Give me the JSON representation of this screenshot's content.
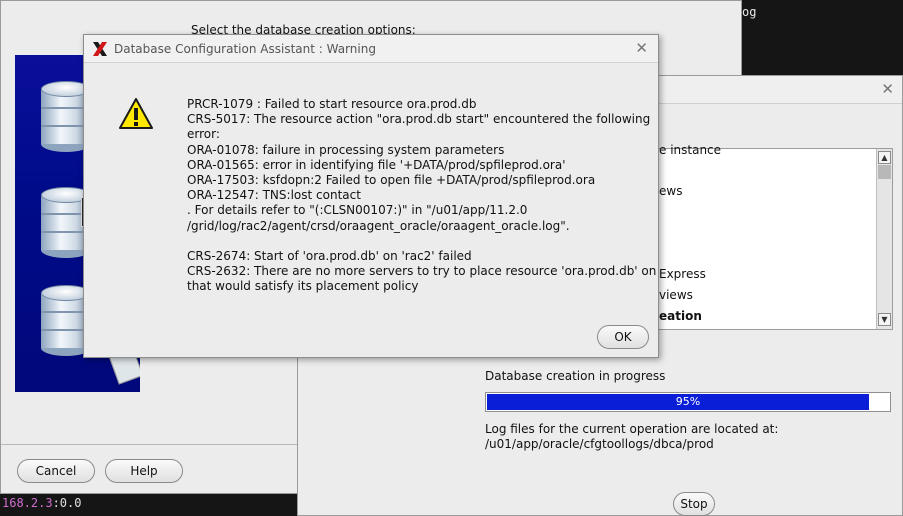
{
  "terminal": {
    "top_right_text": "og",
    "bottom_ip": "168.2.3",
    "bottom_suffix": ":0.0"
  },
  "main_window": {
    "options_title": "Select the database creation options:",
    "cancel_label": "Cancel",
    "help_label": "Help"
  },
  "progress_window": {
    "steps": [
      "e instance",
      "ews",
      "Express",
      "views",
      "eation"
    ],
    "progress_label": "Database creation in progress",
    "progress_percent_text": "95%",
    "progress_fraction": 0.95,
    "log_line1": "Log files for the current operation are located at:",
    "log_line2": "/u01/app/oracle/cfgtoollogs/dbca/prod",
    "stop_label": "Stop"
  },
  "warning_dialog": {
    "title": "Database Configuration Assistant : Warning",
    "message_lines": [
      "PRCR-1079 : Failed to start resource ora.prod.db",
      "CRS-5017: The resource action \"ora.prod.db start\" encountered the following",
      "error:",
      "ORA-01078: failure in processing system parameters",
      "ORA-01565: error in identifying file '+DATA/prod/spfileprod.ora'",
      "ORA-17503: ksfdopn:2 Failed to open file +DATA/prod/spfileprod.ora",
      "ORA-12547: TNS:lost contact",
      ". For details refer to \"(:CLSN00107:)\" in \"/u01/app/11.2.0",
      "/grid/log/rac2/agent/crsd/oraagent_oracle/oraagent_oracle.log\".",
      "",
      "CRS-2674: Start of 'ora.prod.db' on 'rac2' failed",
      "CRS-2632: There are no more servers to try to place resource 'ora.prod.db' on",
      "that would satisfy its placement policy"
    ],
    "ok_label": "OK"
  },
  "colors": {
    "progress_fill": "#0a1ed8",
    "warning_yellow": "#ffe900",
    "app_icon_red": "#d01818"
  }
}
